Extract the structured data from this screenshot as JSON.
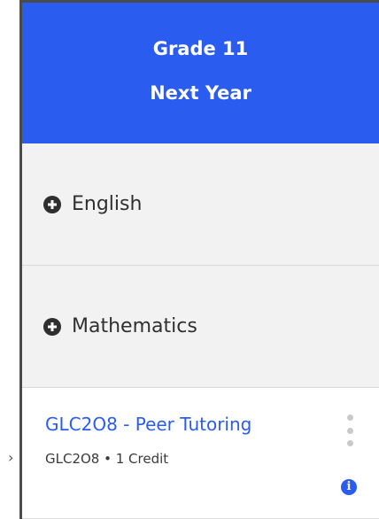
{
  "header": {
    "grade": "Grade 11",
    "year": "Next Year",
    "background_color": "#2b5cf0"
  },
  "subjects": [
    {
      "label": "English",
      "icon": "plus-circle-icon"
    },
    {
      "label": "Mathematics",
      "icon": "plus-circle-icon"
    }
  ],
  "course": {
    "title": "GLC2O8 - Peer Tutoring",
    "subtitle": "GLC2O8 • 1 Credit",
    "menu_icon": "vertical-ellipsis-icon",
    "info_icon": "info-icon",
    "info_glyph": "i",
    "accent_color": "#2b5cf0"
  },
  "drag_handle": {
    "glyph": "›",
    "icon": "chevron-right-icon"
  }
}
